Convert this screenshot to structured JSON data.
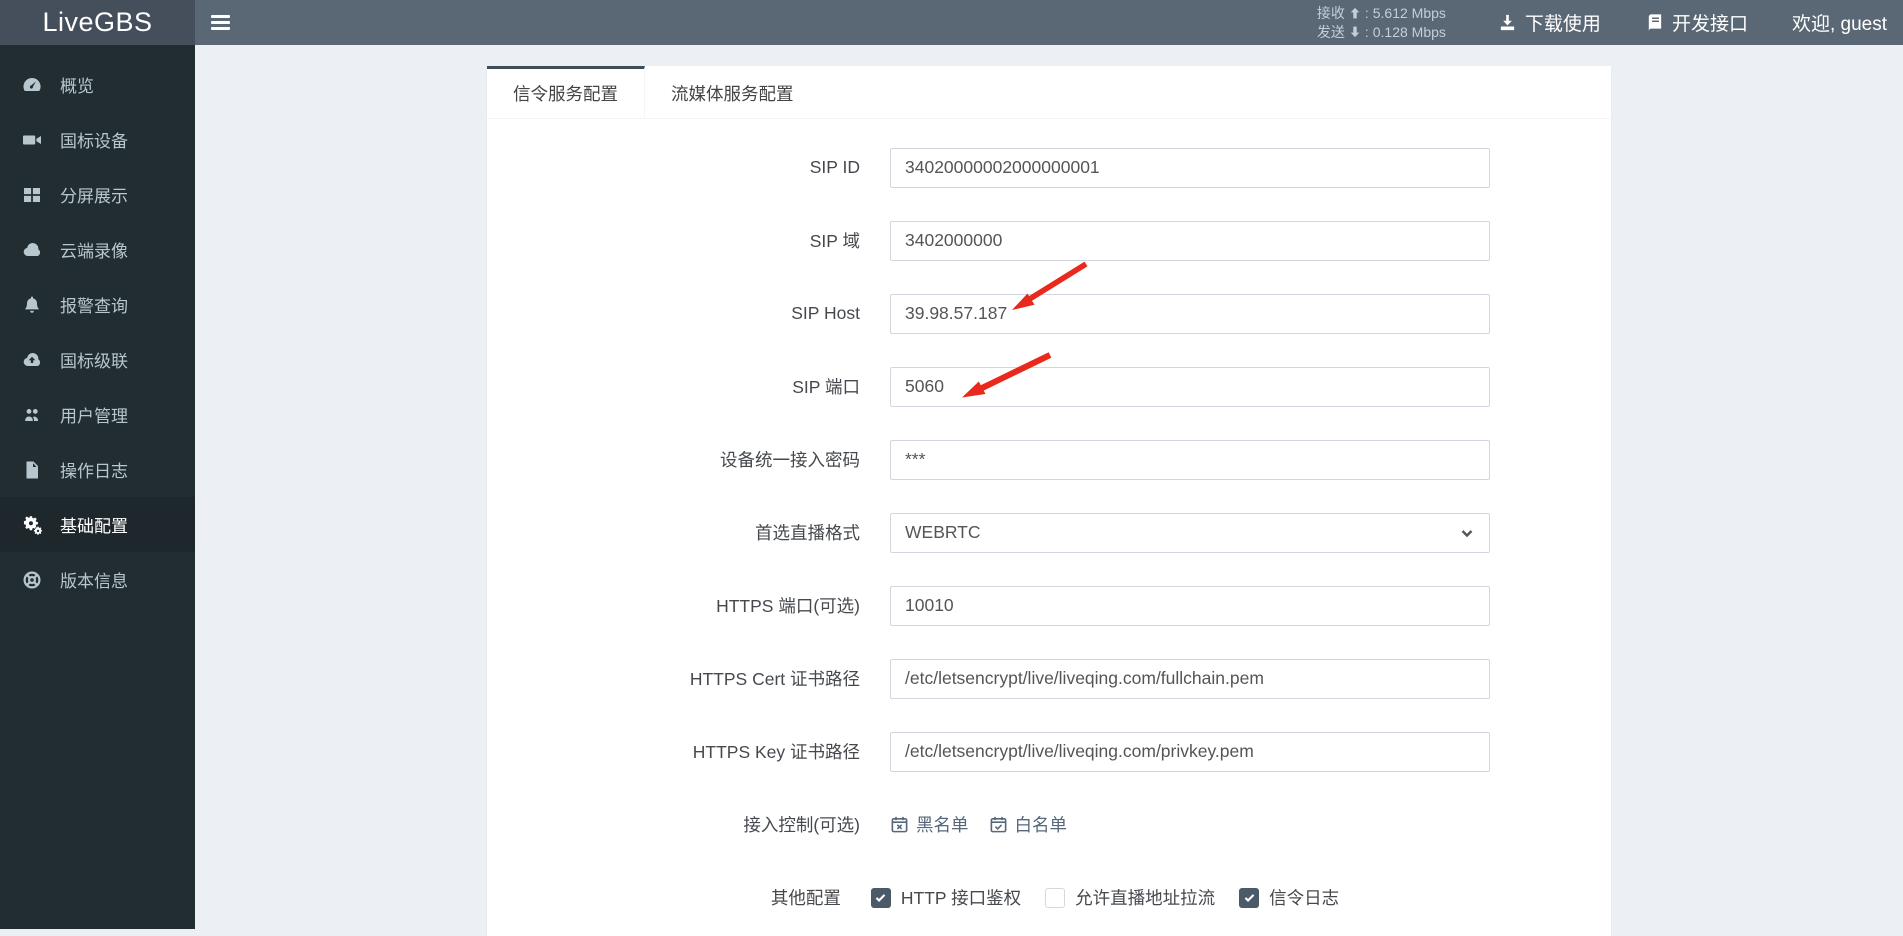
{
  "header": {
    "logo": "LiveGBS",
    "stats": {
      "recv_label": "接收",
      "recv_sep": ":",
      "recv_value": "5.612 Mbps",
      "send_label": "发送",
      "send_sep": ":",
      "send_value": "0.128 Mbps"
    },
    "links": {
      "download": "下载使用",
      "dev_api": "开发接口",
      "welcome": "欢迎, guest"
    }
  },
  "sidebar": {
    "items": [
      {
        "label": "概览",
        "icon": "dashboard-icon",
        "active": false
      },
      {
        "label": "国标设备",
        "icon": "video-camera-icon",
        "active": false
      },
      {
        "label": "分屏展示",
        "icon": "grid-icon",
        "active": false
      },
      {
        "label": "云端录像",
        "icon": "cloud-icon",
        "active": false
      },
      {
        "label": "报警查询",
        "icon": "bell-icon",
        "active": false
      },
      {
        "label": "国标级联",
        "icon": "cloud-upload-icon",
        "active": false
      },
      {
        "label": "用户管理",
        "icon": "users-icon",
        "active": false
      },
      {
        "label": "操作日志",
        "icon": "file-icon",
        "active": false
      },
      {
        "label": "基础配置",
        "icon": "cogs-icon",
        "active": true
      },
      {
        "label": "版本信息",
        "icon": "life-ring-icon",
        "active": false
      }
    ]
  },
  "main": {
    "tabs": [
      {
        "label": "信令服务配置",
        "active": true
      },
      {
        "label": "流媒体服务配置",
        "active": false
      }
    ],
    "form": {
      "fields": [
        {
          "label": "SIP ID",
          "value": "34020000002000000001",
          "type": "input"
        },
        {
          "label": "SIP 域",
          "value": "3402000000",
          "type": "input"
        },
        {
          "label": "SIP Host",
          "value": "39.98.57.187",
          "type": "input",
          "annotated": "red-arrow"
        },
        {
          "label": "SIP 端口",
          "value": "5060",
          "type": "input",
          "annotated": "red-arrow"
        },
        {
          "label": "设备统一接入密码",
          "value": "***",
          "type": "input"
        },
        {
          "label": "首选直播格式",
          "value": "WEBRTC",
          "type": "select"
        },
        {
          "label": "HTTPS 端口(可选)",
          "value": "10010",
          "type": "input"
        },
        {
          "label": "HTTPS Cert 证书路径",
          "value": "/etc/letsencrypt/live/liveqing.com/fullchain.pem",
          "type": "input"
        },
        {
          "label": "HTTPS Key 证书路径",
          "value": "/etc/letsencrypt/live/liveqing.com/privkey.pem",
          "type": "input"
        }
      ],
      "access_control": {
        "label": "接入控制(可选)",
        "links": [
          {
            "label": "黑名单",
            "icon": "calendar-times-icon"
          },
          {
            "label": "白名单",
            "icon": "calendar-check-icon"
          }
        ]
      },
      "other_config": {
        "label": "其他配置",
        "checkboxes": [
          {
            "label": "HTTP 接口鉴权",
            "checked": true
          },
          {
            "label": "允许直播地址拉流",
            "checked": false
          },
          {
            "label": "信令日志",
            "checked": true
          }
        ]
      }
    }
  },
  "colors": {
    "navbar": "#5a6775",
    "logo_bg": "#454f5b",
    "sidebar_bg": "#222d32",
    "sidebar_active_bg": "#1e282c",
    "content_bg": "#ecf0f5",
    "tab_accent": "#3e4d59",
    "input_border": "#d2d6de",
    "checkbox_checked": "#4b5a68",
    "annotation_arrow": "#e8291c"
  }
}
